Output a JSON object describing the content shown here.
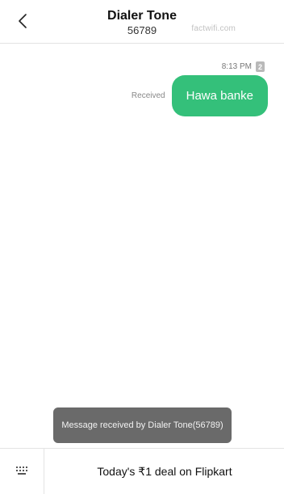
{
  "header": {
    "title": "Dialer Tone",
    "subtitle": "56789",
    "watermark": "factwifi.com",
    "back_icon": "chevron-left-icon"
  },
  "conversation": {
    "messages": [
      {
        "time": "8:13 PM",
        "sim_badge": "2",
        "status": "Received",
        "text": "Hawa banke"
      }
    ]
  },
  "toast": {
    "text": "Message received by Dialer Tone(56789)"
  },
  "bottom_bar": {
    "keypad_icon": "keypad-icon",
    "deal_text": "Today's ₹1 deal on Flipkart"
  },
  "colors": {
    "bubble": "#34c07a",
    "toast": "#6a6a6a",
    "divider": "#e3e3e3"
  }
}
